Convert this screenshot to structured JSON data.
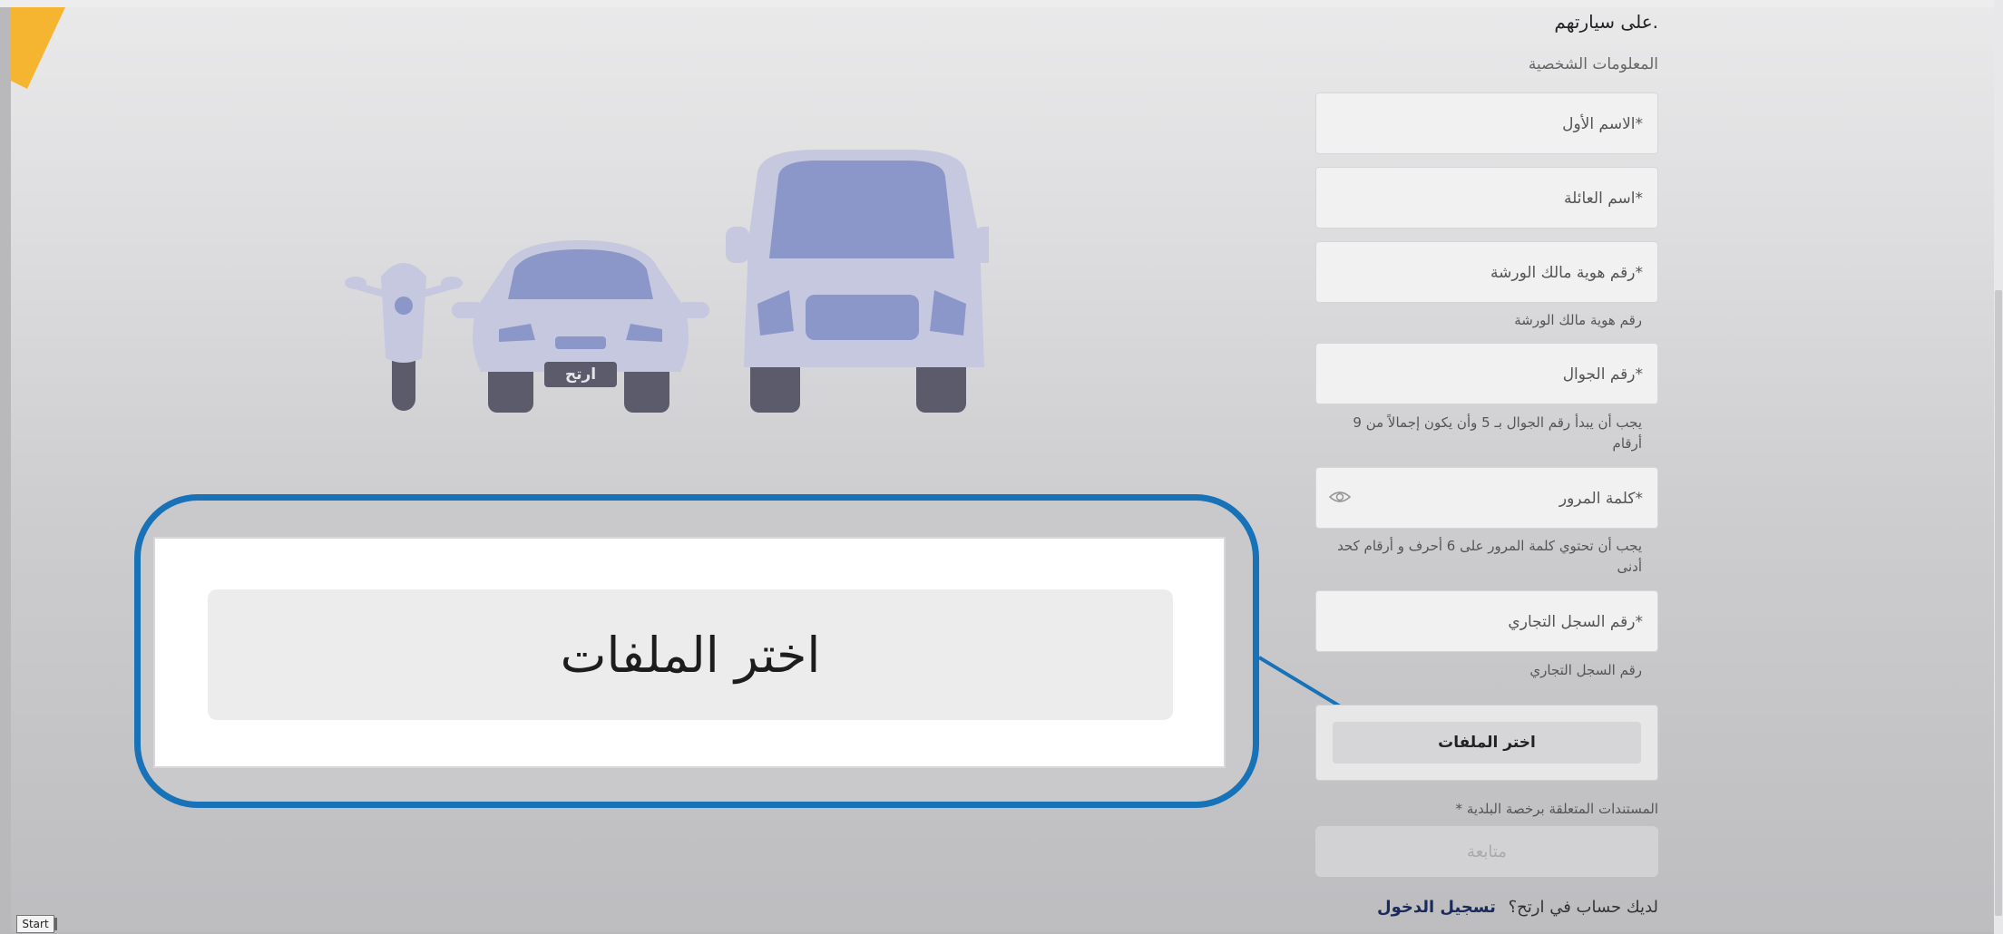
{
  "header": {
    "heading_fragment": "على سيارتهم.",
    "section_label": "المعلومات الشخصية"
  },
  "form": {
    "first_name_placeholder": "الاسم الأول*",
    "last_name_placeholder": "اسم العائلة*",
    "owner_id_placeholder": "رقم هوية مالك الورشة*",
    "owner_id_hint": "رقم هوية مالك الورشة",
    "mobile_placeholder": "رقم الجوال*",
    "mobile_hint_line1": "يجب أن يبدأ رقم الجوال بـ 5 وأن يكون إجمالاً من 9",
    "mobile_hint_line2": "أرقام",
    "password_placeholder": "كلمة المرور*",
    "password_hint_line1": "يجب أن تحتوي كلمة المرور على 6 أحرف و أرقام كحد",
    "password_hint_line2": "أدنى",
    "cr_placeholder": "رقم السجل التجاري*",
    "cr_hint": "رقم السجل التجاري",
    "choose_files_label": "اختر الملفات",
    "documents_label": "المستندات المتعلقة برخصة البلدية *",
    "continue_label": "متابعة"
  },
  "login": {
    "prompt": "لديك حساب في ارتح؟",
    "link_label": "تسجيل الدخول"
  },
  "illustration": {
    "plate_text": "ارتح"
  },
  "zoom_callout": {
    "button_label": "اختر الملفات"
  },
  "taskbar": {
    "start_label": "Start"
  },
  "colors": {
    "accent_corner": "#f6b530",
    "callout_border": "#1772b8",
    "vehicle_fill": "#8b97c8",
    "vehicle_body": "#c5c8de",
    "tire": "#5b5b6b"
  }
}
